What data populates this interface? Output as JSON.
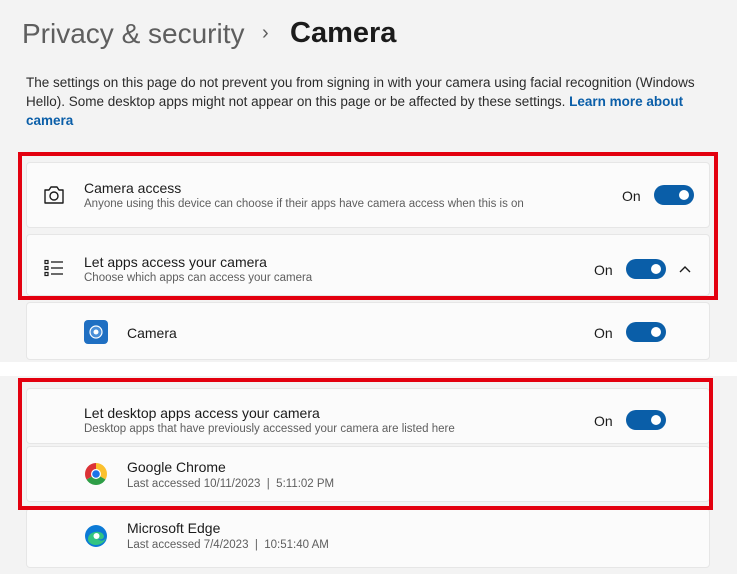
{
  "breadcrumb": {
    "parent": "Privacy & security",
    "separator": "›",
    "current": "Camera"
  },
  "description": {
    "text": "The settings on this page do not prevent you from signing in with your camera using facial recognition (Windows Hello). Some desktop apps might not appear on this page or be affected by these settings.",
    "link": "Learn more about camera"
  },
  "camera_access": {
    "title": "Camera access",
    "subtitle": "Anyone using this device can choose if their apps have camera access when this is on",
    "state": "On",
    "icon": "camera-icon"
  },
  "let_apps": {
    "title": "Let apps access your camera",
    "subtitle": "Choose which apps can access your camera",
    "state": "On",
    "icon": "list-icon",
    "chevron": "chevron-up-icon"
  },
  "apps": [
    {
      "name": "Camera",
      "state": "On",
      "icon": "camera-app-icon"
    }
  ],
  "desktop_apps": {
    "title": "Let desktop apps access your camera",
    "subtitle": "Desktop apps that have previously accessed your camera are listed here",
    "state": "On",
    "items": [
      {
        "name": "Google Chrome",
        "last_accessed": "Last accessed 10/11/2023  |  5:11:02 PM",
        "icon": "chrome-icon"
      },
      {
        "name": "Microsoft Edge",
        "last_accessed": "Last accessed 7/4/2023  |  10:51:40 AM",
        "icon": "edge-icon"
      }
    ]
  },
  "colors": {
    "accent": "#0a5ea8",
    "highlight": "#e3000f"
  }
}
